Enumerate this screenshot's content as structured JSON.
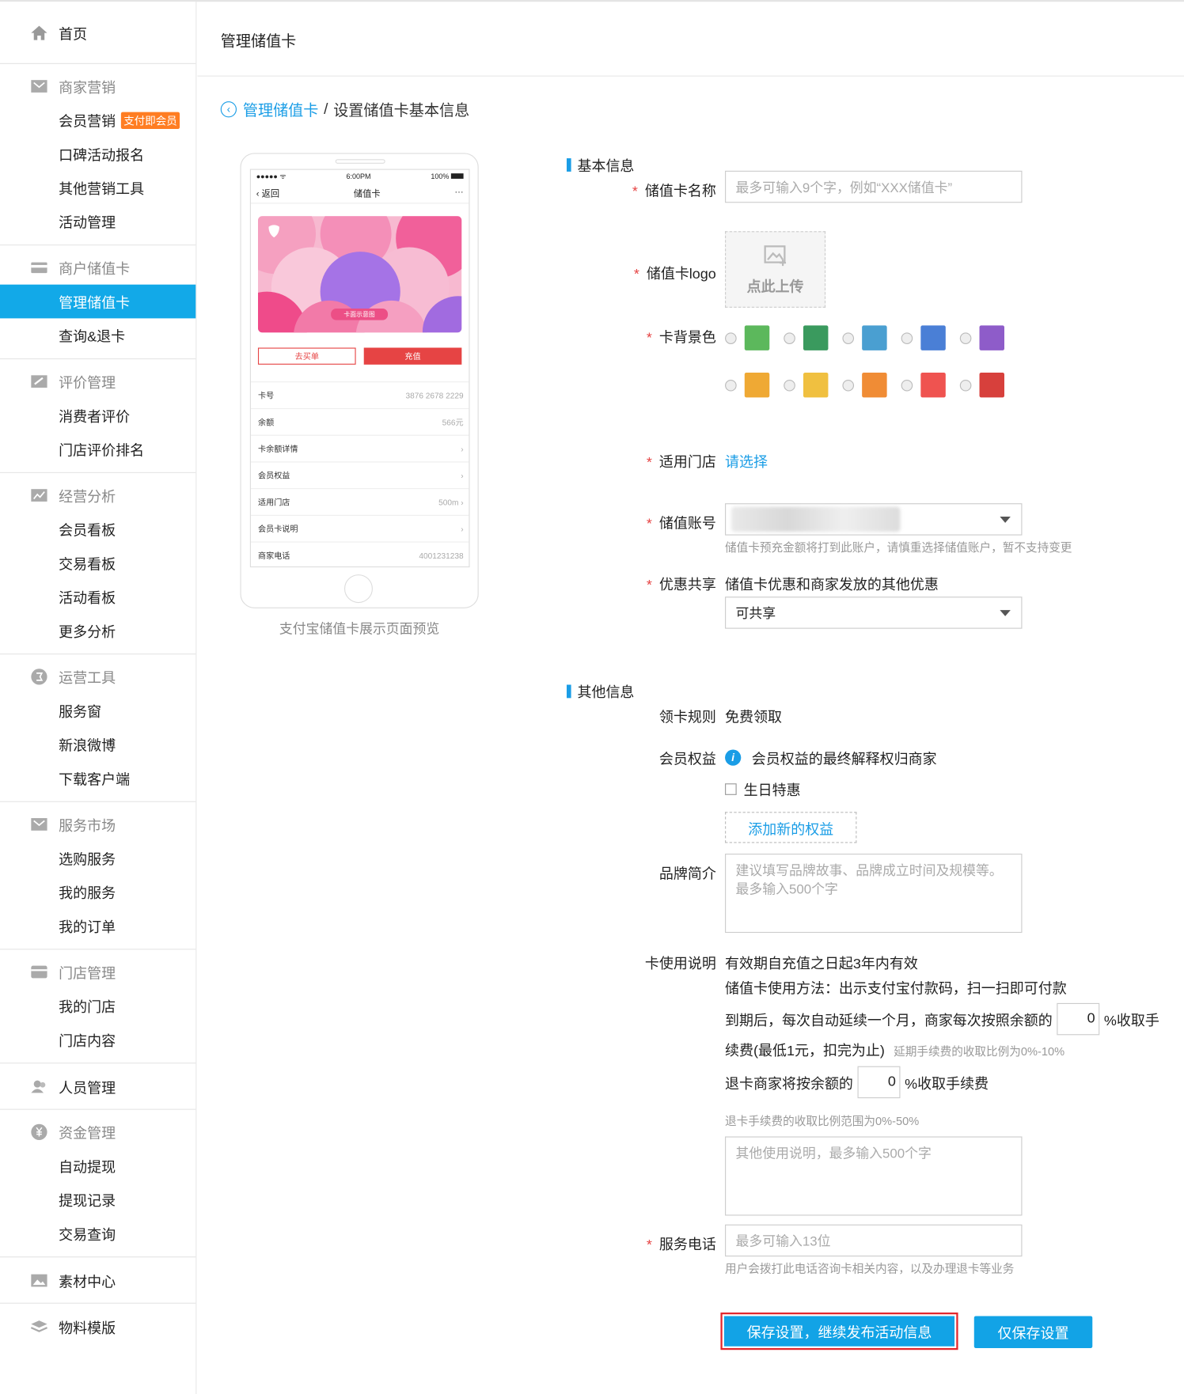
{
  "sidebar": {
    "home": "首页",
    "groups": [
      {
        "title": "商家营销",
        "items": [
          "会员营销",
          "口碑活动报名",
          "其他营销工具",
          "活动管理"
        ],
        "badge": "支付即会员"
      },
      {
        "title": "商户储值卡",
        "items": [
          "管理储值卡",
          "查询&退卡"
        ]
      },
      {
        "title": "评价管理",
        "items": [
          "消费者评价",
          "门店评价排名"
        ]
      },
      {
        "title": "经营分析",
        "items": [
          "会员看板",
          "交易看板",
          "活动看板",
          "更多分析"
        ]
      },
      {
        "title": "运营工具",
        "items": [
          "服务窗",
          "新浪微博",
          "下载客户端"
        ]
      },
      {
        "title": "服务市场",
        "items": [
          "选购服务",
          "我的服务",
          "我的订单"
        ]
      },
      {
        "title": "门店管理",
        "items": [
          "我的门店",
          "门店内容"
        ]
      },
      {
        "title": "人员管理",
        "items": []
      },
      {
        "title": "资金管理",
        "items": [
          "自动提现",
          "提现记录",
          "交易查询"
        ]
      },
      {
        "title": "素材中心",
        "items": []
      },
      {
        "title": "物料模版",
        "items": []
      }
    ]
  },
  "header": {
    "title": "管理储值卡"
  },
  "breadcrumb": {
    "back": "管理储值卡",
    "sep": "/",
    "current": "设置储值卡基本信息"
  },
  "phone": {
    "time": "6:00PM",
    "signal": "●●●●● ᯤ",
    "battery": "100%",
    "back": "返回",
    "title": "储值卡",
    "more": "···",
    "card_label": "卡面示意图",
    "btn_bill": "去买单",
    "btn_recharge": "充值",
    "rows": [
      {
        "k": "卡号",
        "v": "3876 2678 2229"
      },
      {
        "k": "余额",
        "v": "566元"
      },
      {
        "k": "卡余额详情",
        "v": "›"
      },
      {
        "k": "会员权益",
        "v": "›"
      },
      {
        "k": "适用门店",
        "v": "500m ›"
      },
      {
        "k": "会员卡说明",
        "v": "›"
      },
      {
        "k": "商家电话",
        "v": "4001231238"
      }
    ],
    "caption": "支付宝储值卡展示页面预览"
  },
  "form": {
    "basic_title": "基本信息",
    "name_label": "储值卡名称",
    "name_placeholder": "最多可输入9个字，例如“XXX储值卡”",
    "logo_label": "储值卡logo",
    "logo_upload": "点此上传",
    "bg_label": "卡背景色",
    "colors": [
      "#5cb85c",
      "#3a9a5e",
      "#4a9fd1",
      "#4a7fd6",
      "#8e5cc9",
      "#efa934",
      "#f0c040",
      "#f08c35",
      "#ef5350",
      "#d7403c"
    ],
    "store_label": "适用门店",
    "store_link": "请选择",
    "account_label": "储值账号",
    "account_hint": "储值卡预充金额将打到此账户，请慎重选择储值账户，暂不支持变更",
    "share_label": "优惠共享",
    "share_text": "储值卡优惠和商家发放的其他优惠",
    "share_value": "可共享",
    "other_title": "其他信息",
    "rule_label": "领卡规则",
    "rule_value": "免费领取",
    "rights_label": "会员权益",
    "rights_note": "会员权益的最终解释权归商家",
    "birthday": "生日特惠",
    "add_rights": "添加新的权益",
    "brand_label": "品牌简介",
    "brand_placeholder": "建议填写品牌故事、品牌成立时间及规模等。最多输入500个字",
    "usage_label": "卡使用说明",
    "usage_line1": "有效期自充值之日起3年内有效",
    "usage_line2": "储值卡使用方法：出示支付宝付款码，扫一扫即可付款",
    "usage_line3a": "到期后，每次自动延续一个月，商家每次按照余额的",
    "usage_fee": "0",
    "usage_line3b": "%收取手",
    "usage_line4": "续费(最低1元，扣完为止)",
    "usage_line4_hint": "延期手续费的收取比例为0%-10%",
    "refund_a": "退卡商家将按余额的",
    "refund_fee": "0",
    "refund_b": "%收取手续费",
    "refund_hint": "退卡手续费的收取比例范围为0%-50%",
    "other_usage_placeholder": "其他使用说明，最多输入500个字",
    "phone_label": "服务电话",
    "phone_placeholder": "最多可输入13位",
    "phone_hint": "用户会拨打此电话咨询卡相关内容，以及办理退卡等业务",
    "req": "*",
    "btn_primary": "保存设置，继续发布活动信息",
    "btn_secondary": "仅保存设置"
  }
}
